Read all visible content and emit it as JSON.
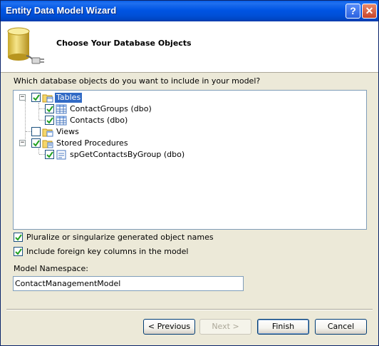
{
  "window": {
    "title": "Entity Data Model Wizard",
    "help_glyph": "?",
    "close_glyph": "✕"
  },
  "header": {
    "title": "Choose Your Database Objects",
    "icon": "database-plug-icon"
  },
  "prompt": "Which database objects do you want to include in your model?",
  "tree": {
    "tables": {
      "label": "Tables",
      "checked": true,
      "expanded": true,
      "selected": true,
      "children": [
        {
          "label": "ContactGroups (dbo)",
          "checked": true
        },
        {
          "label": "Contacts (dbo)",
          "checked": true
        }
      ]
    },
    "views": {
      "label": "Views",
      "checked": false
    },
    "procedures": {
      "label": "Stored Procedures",
      "checked": true,
      "expanded": true,
      "children": [
        {
          "label": "spGetContactsByGroup (dbo)",
          "checked": true
        }
      ]
    }
  },
  "options": {
    "pluralize": {
      "label": "Pluralize or singularize generated object names",
      "checked": true
    },
    "foreign_keys": {
      "label": "Include foreign key columns in the model",
      "checked": true
    }
  },
  "namespace": {
    "label": "Model Namespace:",
    "value": "ContactManagementModel"
  },
  "buttons": {
    "previous": "< Previous",
    "next": "Next >",
    "finish": "Finish",
    "cancel": "Cancel"
  },
  "colors": {
    "titlebar": "#0054e3",
    "selection": "#316ac5",
    "face": "#ece9d8"
  }
}
